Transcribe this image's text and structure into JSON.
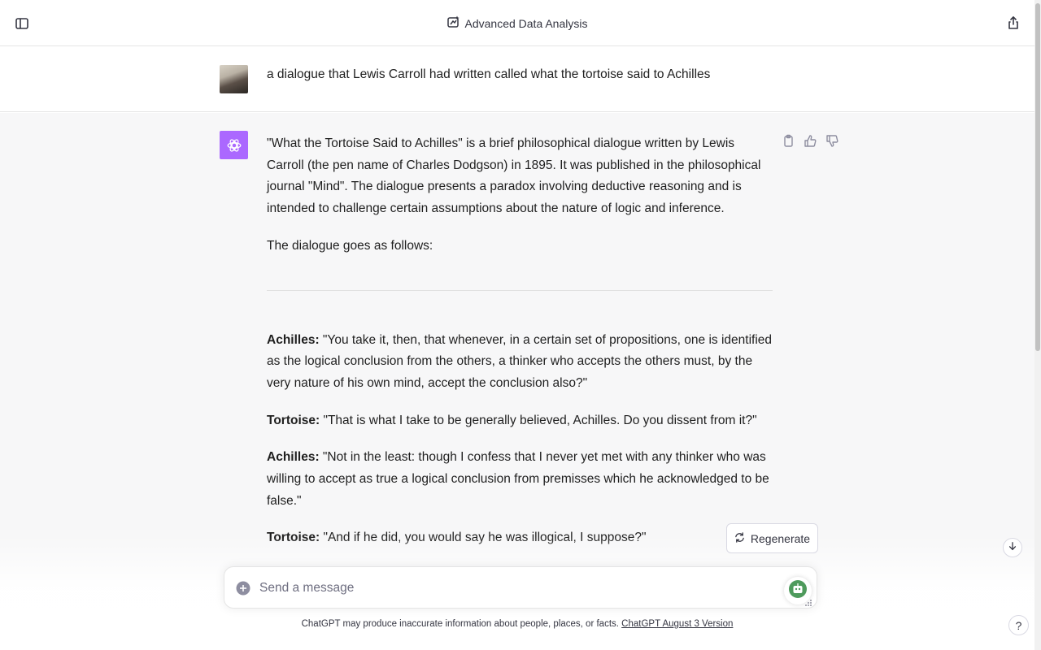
{
  "header": {
    "title": "Advanced Data Analysis",
    "title_icon": "data-analysis-icon",
    "left_icon": "sidebar-toggle-icon",
    "right_icon": "share-icon"
  },
  "user_message": {
    "text": "a dialogue that Lewis Carroll had written called what the tortoise said to Achilles"
  },
  "assistant_message": {
    "intro": "\"What the Tortoise Said to Achilles\" is a brief philosophical dialogue written by Lewis Carroll (the pen name of Charles Dodgson) in 1895. It was published in the philosophical journal \"Mind\". The dialogue presents a paradox involving deductive reasoning and is intended to challenge certain assumptions about the nature of logic and inference.",
    "lead": "The dialogue goes as follows:",
    "lines": [
      {
        "speaker": "Achilles:",
        "text": " \"You take it, then, that whenever, in a certain set of propositions, one is identified as the logical conclusion from the others, a thinker who accepts the others must, by the very nature of his own mind, accept the conclusion also?\""
      },
      {
        "speaker": "Tortoise:",
        "text": " \"That is what I take to be generally believed, Achilles. Do you dissent from it?\""
      },
      {
        "speaker": "Achilles:",
        "text": " \"Not in the least: though I confess that I never yet met with any thinker who was willing to accept as true a logical conclusion from premisses which he acknowledged to be false.\""
      },
      {
        "speaker": "Tortoise:",
        "text": " \"And if he did, you would say he was illogical, I suppose?\""
      }
    ]
  },
  "actions": {
    "regenerate_label": "Regenerate"
  },
  "composer": {
    "placeholder": "Send a message"
  },
  "footer": {
    "disclaimer": "ChatGPT may produce inaccurate information about people, places, or facts.",
    "version_link": "ChatGPT August 3 Version",
    "help": "?"
  },
  "colors": {
    "bot_avatar": "#ab68ff",
    "assistant_bg": "#f7f7f8"
  }
}
